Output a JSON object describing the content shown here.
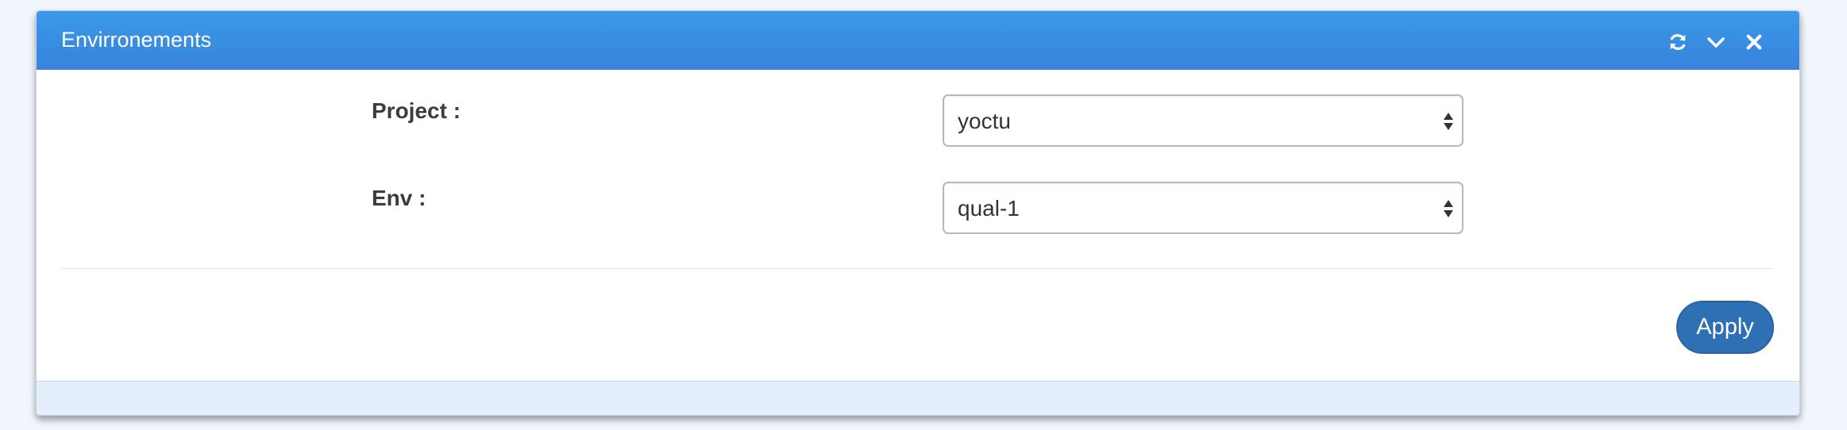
{
  "panel": {
    "title": "Envirronements",
    "header_color": "#3a8de3",
    "tools": [
      "refresh-icon",
      "chevron-down-icon",
      "close-icon"
    ]
  },
  "form": {
    "project": {
      "label": "Project :",
      "value": "yoctu"
    },
    "env": {
      "label": "Env :",
      "value": "qual-1"
    }
  },
  "actions": {
    "apply_label": "Apply",
    "apply_color": "#2f6fb3"
  }
}
